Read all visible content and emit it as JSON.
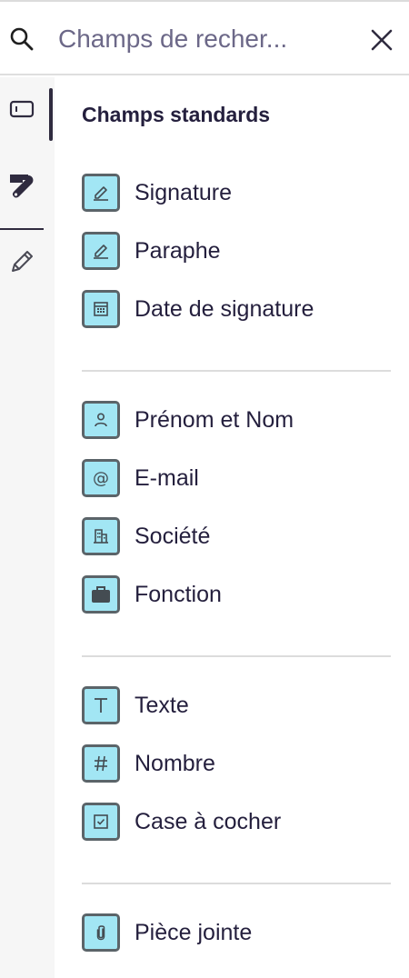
{
  "search": {
    "placeholder": "Champs de recher...",
    "value": ""
  },
  "sidebar": {
    "tabs": [
      {
        "icon": "field-icon",
        "active": true
      },
      {
        "icon": "tools-icon",
        "active": false
      },
      {
        "icon": "pencil-icon",
        "active": false
      }
    ]
  },
  "panel": {
    "section_title": "Champs standards",
    "fields": [
      {
        "label": "Signature",
        "icon": "signature-icon"
      },
      {
        "label": "Paraphe",
        "icon": "initials-icon"
      },
      {
        "label": "Date de signature",
        "icon": "calendar-icon"
      },
      {
        "label": "Prénom et Nom",
        "icon": "person-icon"
      },
      {
        "label": "E-mail",
        "icon": "at-icon"
      },
      {
        "label": "Société",
        "icon": "building-icon"
      },
      {
        "label": "Fonction",
        "icon": "briefcase-icon"
      },
      {
        "label": "Texte",
        "icon": "text-icon"
      },
      {
        "label": "Nombre",
        "icon": "hash-icon"
      },
      {
        "label": "Case à cocher",
        "icon": "checkbox-icon"
      },
      {
        "label": "Pièce jointe",
        "icon": "paperclip-icon"
      }
    ]
  },
  "colors": {
    "icon_fill": "#a2e6f4",
    "icon_border": "#5b6469",
    "text": "#241f3d",
    "muted": "#6c6888"
  }
}
